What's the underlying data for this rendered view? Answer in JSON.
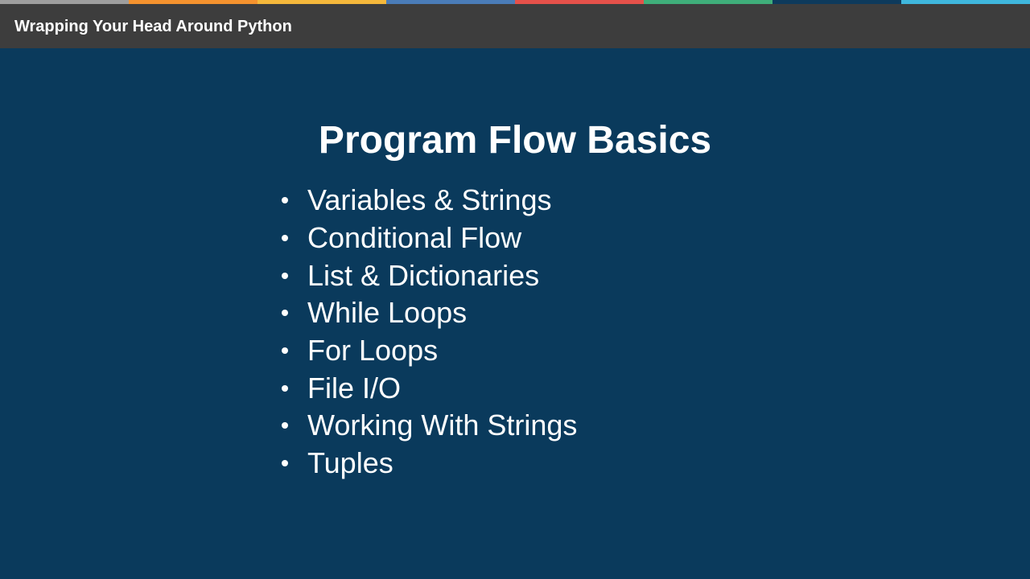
{
  "header": {
    "title": "Wrapping Your Head Around Python"
  },
  "stripe_colors": [
    "#9e9e9e",
    "#f5922e",
    "#f5b83b",
    "#4a7cb8",
    "#e5514a",
    "#3fae7a",
    "#0d3a5c",
    "#3fb7dd"
  ],
  "slide": {
    "title": "Program Flow Basics",
    "bullets": [
      "Variables & Strings",
      "Conditional Flow",
      "List & Dictionaries",
      "While Loops",
      "For Loops",
      "File I/O",
      "Working With Strings",
      "Tuples"
    ]
  },
  "colors": {
    "background": "#0a3a5c",
    "topbar": "#3d3d3d",
    "text": "#ffffff"
  }
}
